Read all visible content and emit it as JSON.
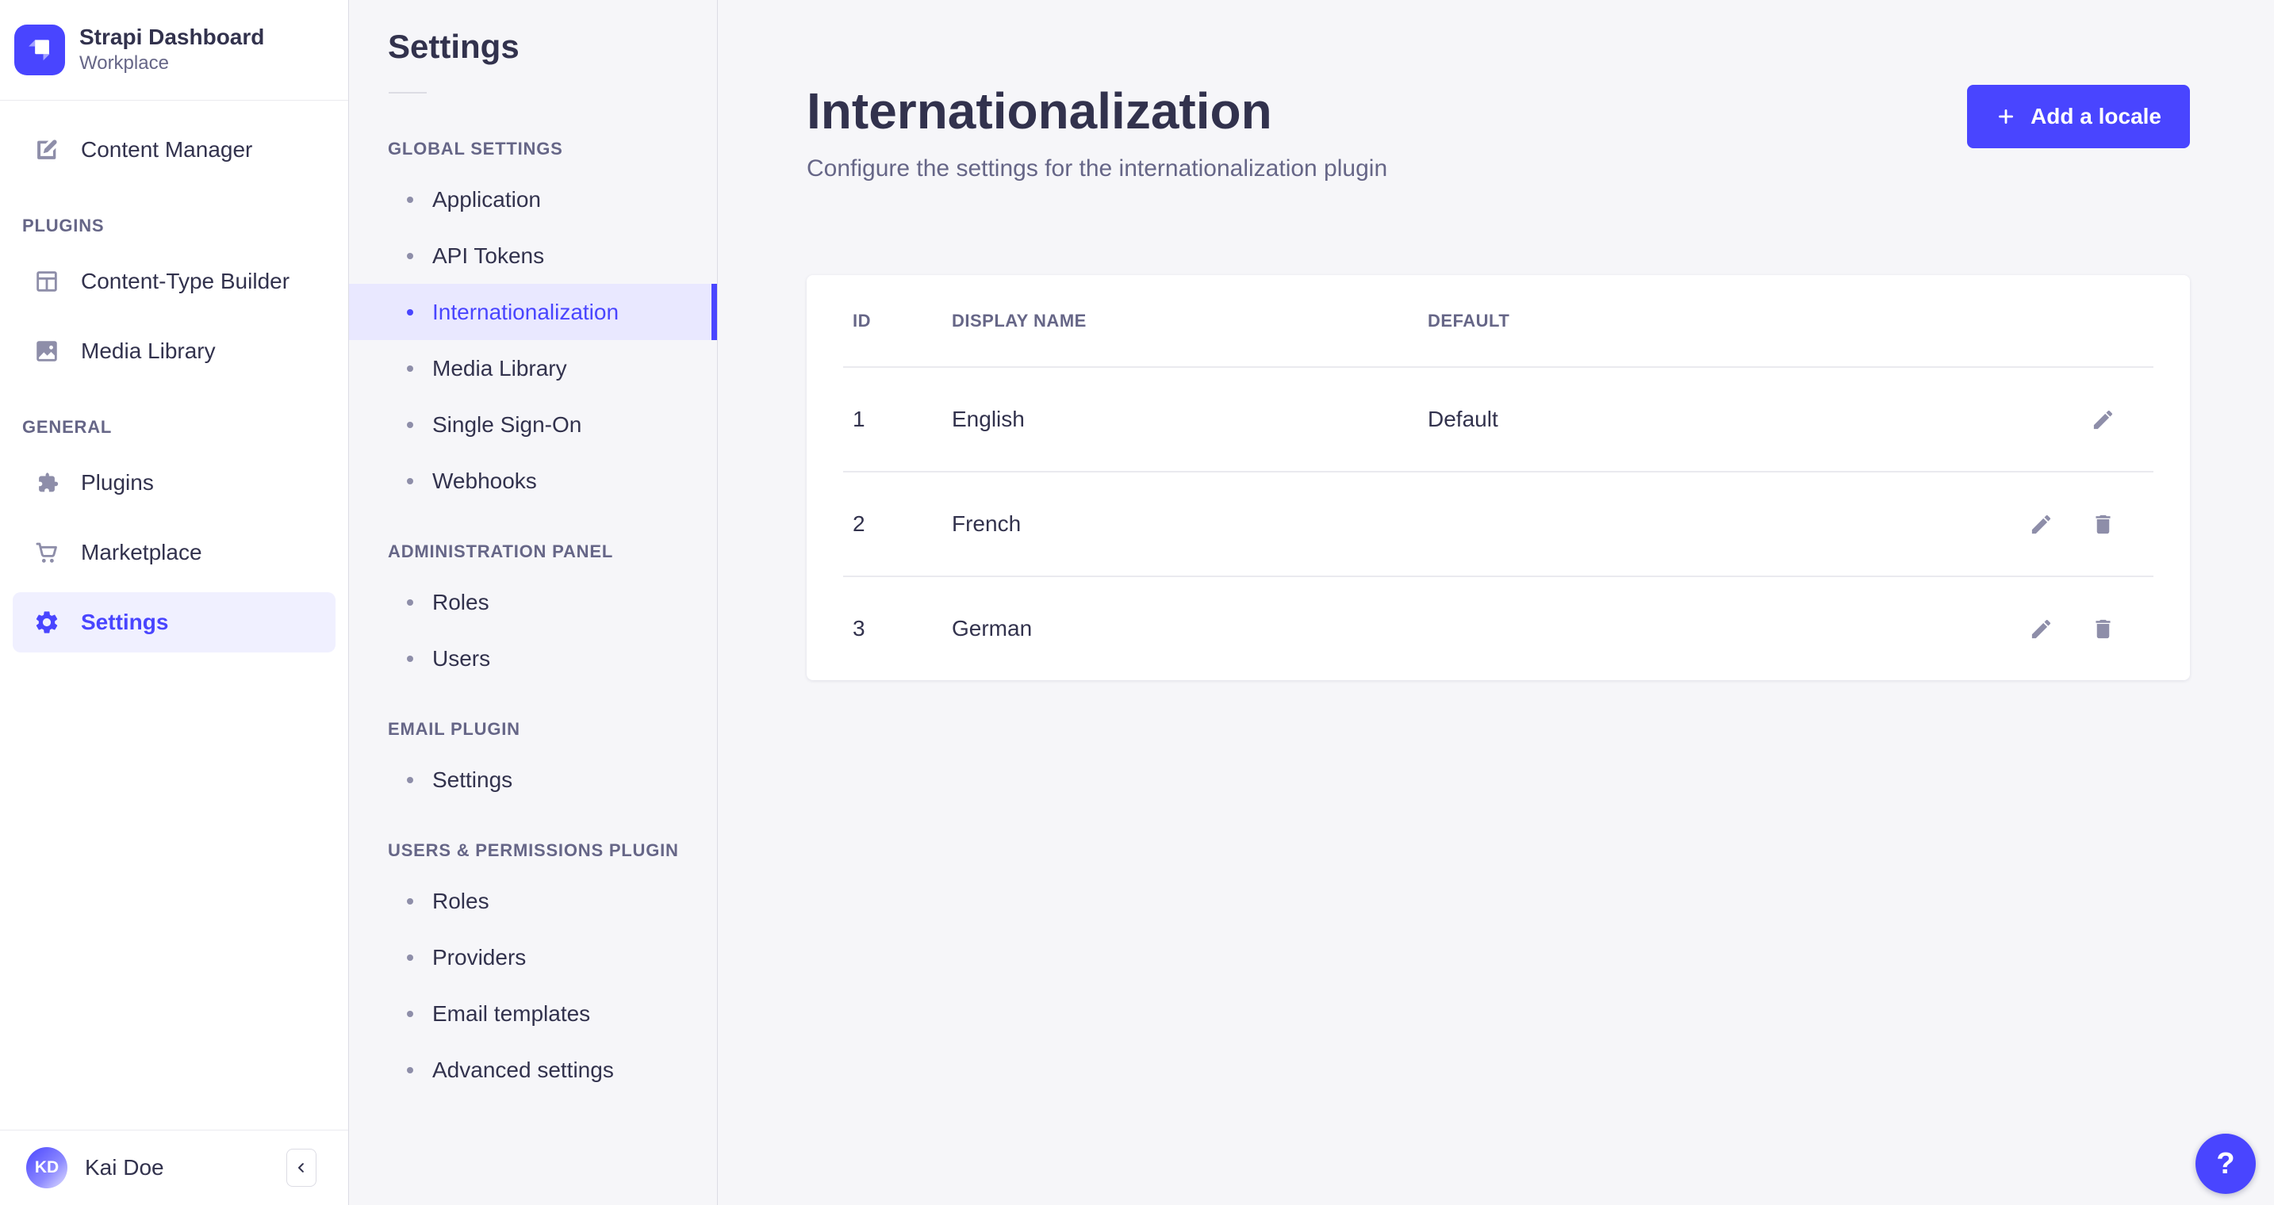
{
  "colors": {
    "primary": "#4945FF",
    "primary_bg": "#F0F0FF",
    "subnav_active_bg": "#E9E8FF",
    "text_dark": "#32324D",
    "text_muted": "#666687",
    "icon_gray": "#8E8EA9",
    "page_bg": "#F6F6F9",
    "border": "#DCDCE4"
  },
  "brand": {
    "title": "Strapi Dashboard",
    "subtitle": "Workplace"
  },
  "sidebar": {
    "nav": [
      {
        "label": "Content Manager",
        "icon": "pen-square"
      },
      {
        "label": "PLUGINS"
      },
      {
        "label": "Content-Type Builder",
        "icon": "layout"
      },
      {
        "label": "Media Library",
        "icon": "picture"
      },
      {
        "label": "GENERAL"
      },
      {
        "label": "Plugins",
        "icon": "puzzle"
      },
      {
        "label": "Marketplace",
        "icon": "cart"
      },
      {
        "label": "Settings",
        "icon": "gear",
        "active": true
      }
    ],
    "user": {
      "initials": "KD",
      "name": "Kai Doe"
    }
  },
  "subnav": {
    "title": "Settings",
    "sections": [
      {
        "label": "GLOBAL SETTINGS",
        "items": [
          {
            "label": "Application"
          },
          {
            "label": "API Tokens"
          },
          {
            "label": "Internationalization",
            "active": true
          },
          {
            "label": "Media Library"
          },
          {
            "label": "Single Sign-On"
          },
          {
            "label": "Webhooks"
          }
        ]
      },
      {
        "label": "ADMINISTRATION PANEL",
        "items": [
          {
            "label": "Roles"
          },
          {
            "label": "Users"
          }
        ]
      },
      {
        "label": "EMAIL PLUGIN",
        "items": [
          {
            "label": "Settings"
          }
        ]
      },
      {
        "label": "USERS & PERMISSIONS PLUGIN",
        "items": [
          {
            "label": "Roles"
          },
          {
            "label": "Providers"
          },
          {
            "label": "Email templates"
          },
          {
            "label": "Advanced settings"
          }
        ]
      }
    ]
  },
  "main": {
    "title": "Internationalization",
    "subtitle": "Configure the settings for the internationalization plugin",
    "add_button_label": "Add a locale",
    "help_label": "?",
    "table": {
      "headers": {
        "id": "ID",
        "name": "DISPLAY NAME",
        "default": "DEFAULT"
      },
      "rows": [
        {
          "id": "1",
          "name": "English",
          "default": "Default"
        },
        {
          "id": "2",
          "name": "French",
          "default": ""
        },
        {
          "id": "3",
          "name": "German",
          "default": ""
        }
      ]
    }
  }
}
